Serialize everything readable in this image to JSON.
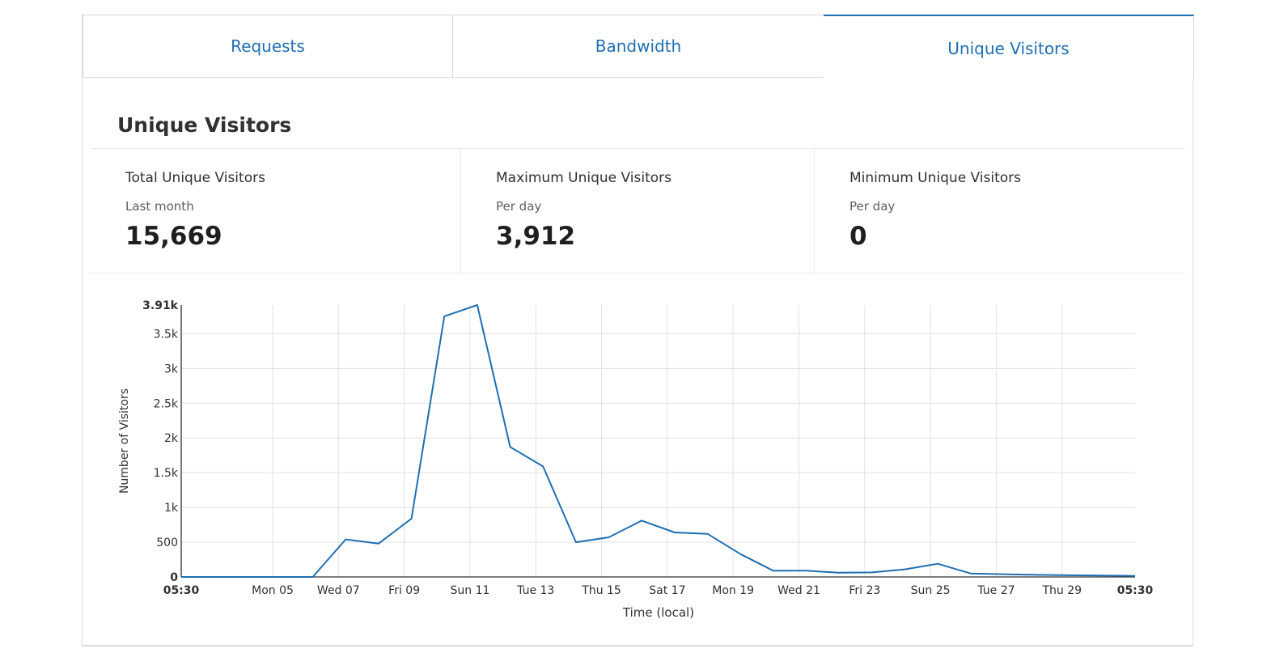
{
  "tabs": [
    {
      "label": "Requests",
      "active": false
    },
    {
      "label": "Bandwidth",
      "active": false
    },
    {
      "label": "Unique Visitors",
      "active": true
    }
  ],
  "section": {
    "title": "Unique Visitors"
  },
  "stats": [
    {
      "label": "Total Unique Visitors",
      "sub": "Last month",
      "value": "15,669"
    },
    {
      "label": "Maximum Unique Visitors",
      "sub": "Per day",
      "value": "3,912"
    },
    {
      "label": "Minimum Unique Visitors",
      "sub": "Per day",
      "value": "0"
    }
  ],
  "colors": {
    "accent": "#1f6fb2",
    "grid": "#e1e1e1",
    "axis": "#323130"
  },
  "chart_data": {
    "type": "line",
    "xlabel": "Time (local)",
    "ylabel": "Number of Visitors",
    "ylim": [
      0,
      3912
    ],
    "y_ticks": [
      "0",
      "500",
      "1k",
      "1.5k",
      "2k",
      "2.5k",
      "3k",
      "3.5k",
      "3.91k"
    ],
    "y_tick_values": [
      0,
      500,
      1000,
      1500,
      2000,
      2500,
      3000,
      3500,
      3912
    ],
    "x_ticks": [
      "05:30",
      "Mon 05",
      "Wed 07",
      "Fri 09",
      "Sun 11",
      "Tue 13",
      "Thu 15",
      "Sat 17",
      "Mon 19",
      "Wed 21",
      "Fri 23",
      "Sun 25",
      "Tue 27",
      "Thu 29",
      "05:30"
    ],
    "grid": true,
    "series": [
      {
        "x": [
          "Mar 03 05:30",
          "Mar 04",
          "Mar 05",
          "Mar 06",
          "Mar 07",
          "Mar 08",
          "Mar 09",
          "Mar 10",
          "Mar 11",
          "Mar 12",
          "Mar 13",
          "Mar 14",
          "Mar 15",
          "Mar 16",
          "Mar 17",
          "Mar 18",
          "Mar 19",
          "Mar 20",
          "Mar 21",
          "Mar 22",
          "Mar 23",
          "Mar 24",
          "Mar 25",
          "Mar 26",
          "Mar 27",
          "Mar 28",
          "Mar 29",
          "Mar 30",
          "Mar 31",
          "Apr 01 05:30"
        ],
        "values": [
          0,
          0,
          0,
          0,
          0,
          540,
          480,
          840,
          3750,
          3912,
          1870,
          1590,
          500,
          570,
          810,
          640,
          620,
          330,
          90,
          90,
          60,
          65,
          110,
          190,
          50,
          40,
          30,
          25,
          20,
          15
        ]
      }
    ]
  }
}
